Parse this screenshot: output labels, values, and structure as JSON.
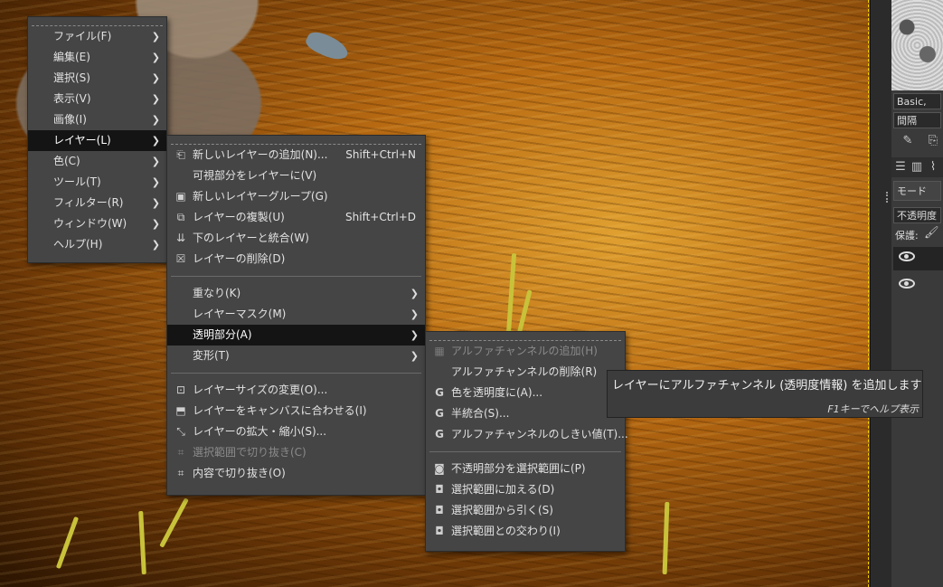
{
  "main_menu": {
    "items": [
      {
        "label": "ファイル(F)"
      },
      {
        "label": "編集(E)"
      },
      {
        "label": "選択(S)"
      },
      {
        "label": "表示(V)"
      },
      {
        "label": "画像(I)"
      },
      {
        "label": "レイヤー(L)"
      },
      {
        "label": "色(C)"
      },
      {
        "label": "ツール(T)"
      },
      {
        "label": "フィルター(R)"
      },
      {
        "label": "ウィンドウ(W)"
      },
      {
        "label": "ヘルプ(H)"
      }
    ],
    "active_index": 5
  },
  "layer_menu": {
    "items": [
      {
        "label": "新しいレイヤーの追加(N)...",
        "shortcut": "Shift+Ctrl+N",
        "icon": "new-layer-icon"
      },
      {
        "label": "可視部分をレイヤーに(V)",
        "shortcut": "",
        "icon": ""
      },
      {
        "label": "新しいレイヤーグループ(G)",
        "shortcut": "",
        "icon": "new-layer-group-icon"
      },
      {
        "label": "レイヤーの複製(U)",
        "shortcut": "Shift+Ctrl+D",
        "icon": "duplicate-layer-icon"
      },
      {
        "label": "下のレイヤーと統合(W)",
        "shortcut": "",
        "icon": "merge-down-icon"
      },
      {
        "label": "レイヤーの削除(D)",
        "shortcut": "",
        "icon": "delete-layer-icon"
      },
      {
        "label": "重なり(K)",
        "submenu": true
      },
      {
        "label": "レイヤーマスク(M)",
        "submenu": true
      },
      {
        "label": "透明部分(A)",
        "submenu": true,
        "active": true
      },
      {
        "label": "変形(T)",
        "submenu": true
      },
      {
        "label": "レイヤーサイズの変更(O)...",
        "icon": "layer-boundary-size-icon"
      },
      {
        "label": "レイヤーをキャンバスに合わせる(I)",
        "icon": "layer-to-image-size-icon"
      },
      {
        "label": "レイヤーの拡大・縮小(S)...",
        "icon": "scale-layer-icon"
      },
      {
        "label": "選択範囲で切り抜き(C)",
        "icon": "crop-to-selection-icon",
        "disabled": true
      },
      {
        "label": "内容で切り抜き(O)",
        "icon": "crop-to-content-icon"
      }
    ]
  },
  "transparency_menu": {
    "items": [
      {
        "label": "アルファチャンネルの追加(H)",
        "icon": "add-alpha-icon",
        "disabled": true
      },
      {
        "label": "アルファチャンネルの削除(R)",
        "icon": ""
      },
      {
        "label": "色を透明度に(A)...",
        "icon": "gegl-icon"
      },
      {
        "label": "半統合(S)...",
        "icon": "gegl-icon"
      },
      {
        "label": "アルファチャンネルのしきい値(T)...",
        "icon": "gegl-icon"
      },
      {
        "label": "不透明部分を選択範囲に(P)",
        "icon": "alpha-to-selection-icon"
      },
      {
        "label": "選択範囲に加える(D)",
        "icon": "add-to-selection-icon"
      },
      {
        "label": "選択範囲から引く(S)",
        "icon": "subtract-from-selection-icon"
      },
      {
        "label": "選択範囲との交わり(I)",
        "icon": "intersect-selection-icon"
      }
    ]
  },
  "tooltip": {
    "text": "レイヤーにアルファチャンネル (透明度情報) を追加します",
    "hint": "F1キーでヘルプ表示"
  },
  "dock": {
    "brush_name": "Basic,",
    "spacing_label": "間隔",
    "mode_label": "モード",
    "opacity_label": "不透明度",
    "lock_label": "保護:"
  },
  "colors": {
    "menu_bg": "#454545",
    "highlight_bg": "#141414",
    "canvas_border": "#f0d000"
  }
}
